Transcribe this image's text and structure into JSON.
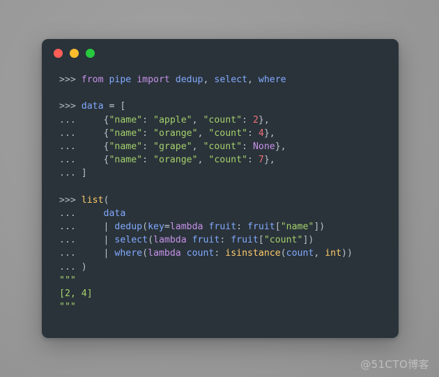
{
  "window": {
    "background_color": "#2a333a",
    "page_background_color": "#9a9a9a",
    "traffic_lights": [
      {
        "name": "close",
        "color": "#ff5f56"
      },
      {
        "name": "minimize",
        "color": "#ffbd2e"
      },
      {
        "name": "maximize",
        "color": "#27c93f"
      }
    ]
  },
  "palette": {
    "prompt": "#b0bec5",
    "keyword": "#c792ea",
    "name": "#82aaff",
    "builtin": "#ffcb6b",
    "string": "#a5d16c",
    "number": "#f07178",
    "punctuation": "#b9c2c7",
    "output": "#a5d16c"
  },
  "code": {
    "language": "python",
    "plain_text": ">>> from pipe import dedup, select, where\n\n>>> data = [\n...     {\"name\": \"apple\", \"count\": 2},\n...     {\"name\": \"orange\", \"count\": 4},\n...     {\"name\": \"grape\", \"count\": None},\n...     {\"name\": \"orange\", \"count\": 7},\n... ]\n\n>>> list(\n...     data\n...     | dedup(key=lambda fruit: fruit[\"name\"])\n...     | select(lambda fruit: fruit[\"count\"])\n...     | where(lambda count: isinstance(count, int))\n... )\n\"\"\"\n[2, 4]\n\"\"\"",
    "lines": [
      {
        "id": "l1",
        "tokens": [
          {
            "t": "prompt",
            "v": ">>> "
          },
          {
            "t": "kw",
            "v": "from"
          },
          {
            "t": "plain",
            "v": " "
          },
          {
            "t": "name",
            "v": "pipe"
          },
          {
            "t": "plain",
            "v": " "
          },
          {
            "t": "kw",
            "v": "import"
          },
          {
            "t": "plain",
            "v": " "
          },
          {
            "t": "name",
            "v": "dedup"
          },
          {
            "t": "punct",
            "v": ", "
          },
          {
            "t": "name",
            "v": "select"
          },
          {
            "t": "punct",
            "v": ", "
          },
          {
            "t": "name",
            "v": "where"
          }
        ]
      },
      {
        "id": "l2",
        "tokens": []
      },
      {
        "id": "l3",
        "tokens": [
          {
            "t": "prompt",
            "v": ">>> "
          },
          {
            "t": "name",
            "v": "data"
          },
          {
            "t": "op",
            "v": " = "
          },
          {
            "t": "punct",
            "v": "["
          }
        ]
      },
      {
        "id": "l4",
        "tokens": [
          {
            "t": "prompt",
            "v": "... "
          },
          {
            "t": "punct",
            "v": "    {"
          },
          {
            "t": "str",
            "v": "\"name\""
          },
          {
            "t": "punct",
            "v": ": "
          },
          {
            "t": "str",
            "v": "\"apple\""
          },
          {
            "t": "punct",
            "v": ", "
          },
          {
            "t": "str",
            "v": "\"count\""
          },
          {
            "t": "punct",
            "v": ": "
          },
          {
            "t": "num",
            "v": "2"
          },
          {
            "t": "punct",
            "v": "},"
          }
        ]
      },
      {
        "id": "l5",
        "tokens": [
          {
            "t": "prompt",
            "v": "... "
          },
          {
            "t": "punct",
            "v": "    {"
          },
          {
            "t": "str",
            "v": "\"name\""
          },
          {
            "t": "punct",
            "v": ": "
          },
          {
            "t": "str",
            "v": "\"orange\""
          },
          {
            "t": "punct",
            "v": ", "
          },
          {
            "t": "str",
            "v": "\"count\""
          },
          {
            "t": "punct",
            "v": ": "
          },
          {
            "t": "num",
            "v": "4"
          },
          {
            "t": "punct",
            "v": "},"
          }
        ]
      },
      {
        "id": "l6",
        "tokens": [
          {
            "t": "prompt",
            "v": "... "
          },
          {
            "t": "punct",
            "v": "    {"
          },
          {
            "t": "str",
            "v": "\"name\""
          },
          {
            "t": "punct",
            "v": ": "
          },
          {
            "t": "str",
            "v": "\"grape\""
          },
          {
            "t": "punct",
            "v": ", "
          },
          {
            "t": "str",
            "v": "\"count\""
          },
          {
            "t": "punct",
            "v": ": "
          },
          {
            "t": "kw",
            "v": "None"
          },
          {
            "t": "punct",
            "v": "},"
          }
        ]
      },
      {
        "id": "l7",
        "tokens": [
          {
            "t": "prompt",
            "v": "... "
          },
          {
            "t": "punct",
            "v": "    {"
          },
          {
            "t": "str",
            "v": "\"name\""
          },
          {
            "t": "punct",
            "v": ": "
          },
          {
            "t": "str",
            "v": "\"orange\""
          },
          {
            "t": "punct",
            "v": ", "
          },
          {
            "t": "str",
            "v": "\"count\""
          },
          {
            "t": "punct",
            "v": ": "
          },
          {
            "t": "num",
            "v": "7"
          },
          {
            "t": "punct",
            "v": "},"
          }
        ]
      },
      {
        "id": "l8",
        "tokens": [
          {
            "t": "prompt",
            "v": "... "
          },
          {
            "t": "punct",
            "v": "]"
          }
        ]
      },
      {
        "id": "l9",
        "tokens": []
      },
      {
        "id": "l10",
        "tokens": [
          {
            "t": "prompt",
            "v": ">>> "
          },
          {
            "t": "builtin",
            "v": "list"
          },
          {
            "t": "punct",
            "v": "("
          }
        ]
      },
      {
        "id": "l11",
        "tokens": [
          {
            "t": "prompt",
            "v": "... "
          },
          {
            "t": "plain",
            "v": "    "
          },
          {
            "t": "name",
            "v": "data"
          }
        ]
      },
      {
        "id": "l12",
        "tokens": [
          {
            "t": "prompt",
            "v": "... "
          },
          {
            "t": "plain",
            "v": "    "
          },
          {
            "t": "pipe",
            "v": "| "
          },
          {
            "t": "name",
            "v": "dedup"
          },
          {
            "t": "punct",
            "v": "("
          },
          {
            "t": "name",
            "v": "key"
          },
          {
            "t": "op",
            "v": "="
          },
          {
            "t": "kw",
            "v": "lambda"
          },
          {
            "t": "plain",
            "v": " "
          },
          {
            "t": "name",
            "v": "fruit"
          },
          {
            "t": "punct",
            "v": ": "
          },
          {
            "t": "name",
            "v": "fruit"
          },
          {
            "t": "punct",
            "v": "["
          },
          {
            "t": "str",
            "v": "\"name\""
          },
          {
            "t": "punct",
            "v": "])"
          }
        ]
      },
      {
        "id": "l13",
        "tokens": [
          {
            "t": "prompt",
            "v": "... "
          },
          {
            "t": "plain",
            "v": "    "
          },
          {
            "t": "pipe",
            "v": "| "
          },
          {
            "t": "name",
            "v": "select"
          },
          {
            "t": "punct",
            "v": "("
          },
          {
            "t": "kw",
            "v": "lambda"
          },
          {
            "t": "plain",
            "v": " "
          },
          {
            "t": "name",
            "v": "fruit"
          },
          {
            "t": "punct",
            "v": ": "
          },
          {
            "t": "name",
            "v": "fruit"
          },
          {
            "t": "punct",
            "v": "["
          },
          {
            "t": "str",
            "v": "\"count\""
          },
          {
            "t": "punct",
            "v": "])"
          }
        ]
      },
      {
        "id": "l14",
        "tokens": [
          {
            "t": "prompt",
            "v": "... "
          },
          {
            "t": "plain",
            "v": "    "
          },
          {
            "t": "pipe",
            "v": "| "
          },
          {
            "t": "name",
            "v": "where"
          },
          {
            "t": "punct",
            "v": "("
          },
          {
            "t": "kw",
            "v": "lambda"
          },
          {
            "t": "plain",
            "v": " "
          },
          {
            "t": "name",
            "v": "count"
          },
          {
            "t": "punct",
            "v": ": "
          },
          {
            "t": "builtin",
            "v": "isinstance"
          },
          {
            "t": "punct",
            "v": "("
          },
          {
            "t": "name",
            "v": "count"
          },
          {
            "t": "punct",
            "v": ", "
          },
          {
            "t": "builtin",
            "v": "int"
          },
          {
            "t": "punct",
            "v": "))"
          }
        ]
      },
      {
        "id": "l15",
        "tokens": [
          {
            "t": "prompt",
            "v": "... "
          },
          {
            "t": "punct",
            "v": ")"
          }
        ]
      },
      {
        "id": "l16",
        "tokens": [
          {
            "t": "out",
            "v": "\"\"\""
          }
        ]
      },
      {
        "id": "l17",
        "tokens": [
          {
            "t": "out",
            "v": "[2, 4]"
          }
        ]
      },
      {
        "id": "l18",
        "tokens": [
          {
            "t": "out",
            "v": "\"\"\""
          }
        ]
      }
    ]
  },
  "watermark": {
    "text": "@51CTO博客"
  }
}
